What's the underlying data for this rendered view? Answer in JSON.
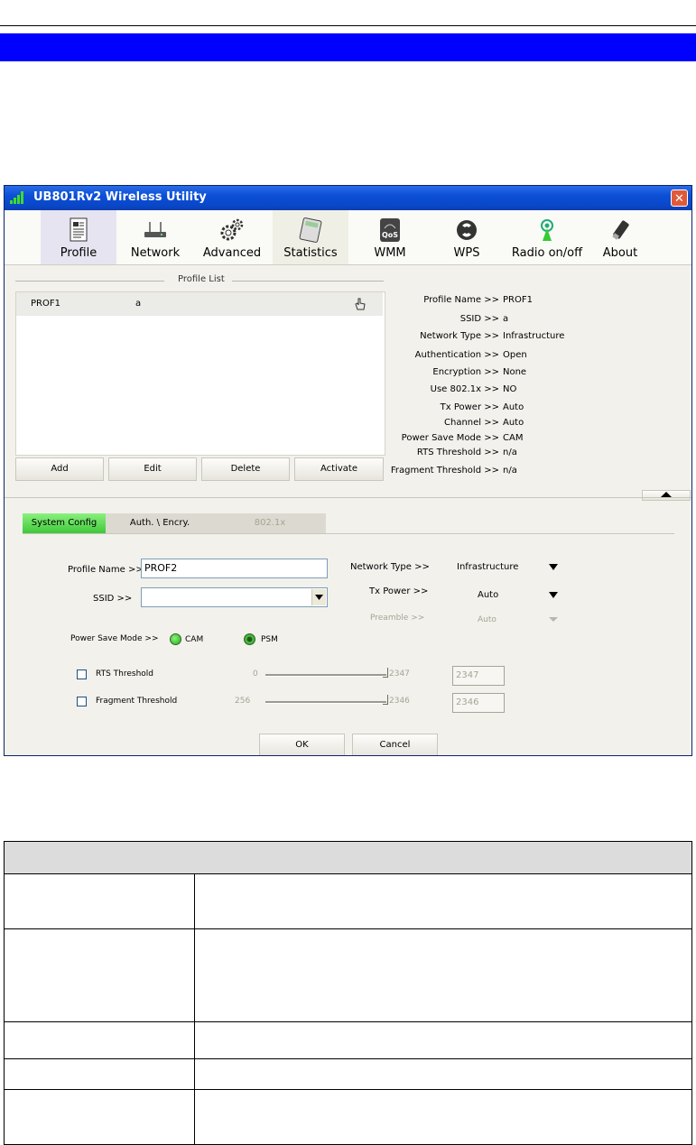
{
  "window": {
    "title": "UB801Rv2 Wireless Utility",
    "close_glyph": "✕"
  },
  "toolbar": {
    "items": [
      {
        "label": "Profile",
        "icon": "document-icon",
        "active": true
      },
      {
        "label": "Network",
        "icon": "router-icon"
      },
      {
        "label": "Advanced",
        "icon": "gears-icon"
      },
      {
        "label": "Statistics",
        "icon": "calculator-icon"
      },
      {
        "label": "WMM",
        "icon": "qos-icon"
      },
      {
        "label": "WPS",
        "icon": "wps-icon"
      },
      {
        "label": "Radio on/off",
        "icon": "radio-antenna-icon"
      },
      {
        "label": "About",
        "icon": "usb-adapter-icon"
      }
    ]
  },
  "profile_list": {
    "heading": "Profile List",
    "rows": [
      {
        "name": "PROF1",
        "ssid": "a",
        "icon": "hand-pointer-icon"
      }
    ],
    "buttons": {
      "add": "Add",
      "edit": "Edit",
      "delete": "Delete",
      "activate": "Activate"
    }
  },
  "profile_info": {
    "profile_name_label": "Profile Name >>",
    "profile_name_value": "PROF1",
    "ssid_label": "SSID >>",
    "ssid_value": "a",
    "network_type_label": "Network Type >>",
    "network_type_value": "Infrastructure",
    "authentication_label": "Authentication >>",
    "authentication_value": "Open",
    "encryption_label": "Encryption >>",
    "encryption_value": "None",
    "use8021x_label": "Use 802.1x >>",
    "use8021x_value": "NO",
    "tx_power_label": "Tx Power >>",
    "tx_power_value": "Auto",
    "channel_label": "Channel >>",
    "channel_value": "Auto",
    "power_save_label": "Power Save Mode >>",
    "power_save_value": "CAM",
    "rts_label": "RTS Threshold >>",
    "rts_value": "n/a",
    "frag_label": "Fragment Threshold >>",
    "frag_value": "n/a"
  },
  "tabs": [
    {
      "label": "System Config",
      "active": true
    },
    {
      "label": "Auth. \\ Encry."
    },
    {
      "label": "802.1x",
      "disabled": true
    }
  ],
  "config": {
    "profile_name_label": "Profile Name >>",
    "profile_name_value": "PROF2",
    "ssid_label": "SSID >>",
    "ssid_value": "",
    "network_type_label": "Network Type >>",
    "network_type_value": "Infrastructure",
    "tx_power_label": "Tx Power >>",
    "tx_power_value": "Auto",
    "preamble_label": "Preamble >>",
    "preamble_value": "Auto",
    "power_save_label": "Power Save Mode >>",
    "cam_label": "CAM",
    "psm_label": "PSM",
    "rts_label": "RTS Threshold",
    "rts_min": "0",
    "rts_max": "2347",
    "rts_value": "2347",
    "frag_label": "Fragment Threshold",
    "frag_min": "256",
    "frag_max": "2346",
    "frag_value": "2346",
    "ok": "OK",
    "cancel": "Cancel"
  },
  "colors": {
    "title_blue": "#0b4fd6",
    "accent_bar": "#0000ff",
    "active_tab_green": "#5ee05a"
  }
}
